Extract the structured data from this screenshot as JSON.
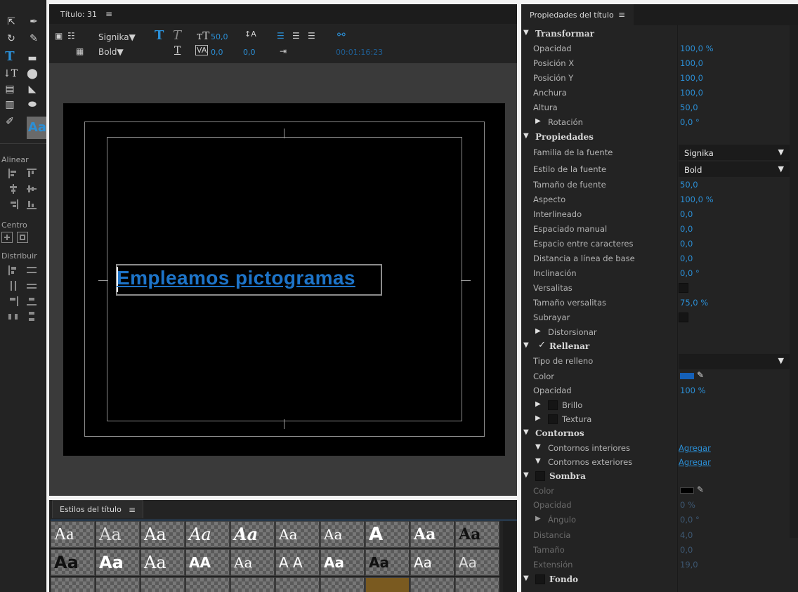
{
  "tools": {
    "labels": {
      "align": "Alinear",
      "center": "Centro",
      "distribute": "Distribuir"
    },
    "icons": [
      "selection-arrow-icon",
      "pen-icon",
      "rotate-icon",
      "add-anchor-icon",
      "type-tool-icon",
      "rectangle-icon",
      "vertical-type-icon",
      "ellipse-icon",
      "area-type-icon",
      "wedge-icon",
      "vertical-area-type-icon",
      "circle-icon",
      "path-type-icon",
      "style-swatch-icon"
    ]
  },
  "editor": {
    "tab_title": "Título: 31",
    "menu_glyph": "≡",
    "font_family": "Signika",
    "font_style": "Bold",
    "font_size": "50,0",
    "kerning": "0,0",
    "leading": "0,0",
    "timecode": "00:01:16:23",
    "headline_text": "Empleamos pictogramas"
  },
  "styles_panel": {
    "tab_title": "Estilos del título",
    "menu_glyph": "≡",
    "row1": [
      "Aa",
      "Aa",
      "Aa",
      "Aa",
      "Aa",
      "Aa",
      "Aa",
      "A",
      "Aa",
      "Aa"
    ],
    "row2": [
      "Aa",
      "Aa",
      "Aa",
      "AA",
      "Aa",
      "A A",
      "Aa",
      "Aa",
      "Aa",
      "Aa"
    ]
  },
  "properties": {
    "tab_title": "Propiedades del título",
    "menu_glyph": "≡",
    "transform_header": "Transformar",
    "rows_transform": [
      {
        "label": "Opacidad",
        "value": "100,0 %"
      },
      {
        "label": "Posición X",
        "value": "100,0"
      },
      {
        "label": "Posición Y",
        "value": "100,0"
      },
      {
        "label": "Anchura",
        "value": "100,0"
      },
      {
        "label": "Altura",
        "value": "50,0"
      }
    ],
    "rotation": {
      "label": "Rotación",
      "value": "0,0 °"
    },
    "props_header": "Propiedades",
    "font_family_label": "Familia de la fuente",
    "font_family_value": "Signika",
    "font_style_label": "Estilo de la fuente",
    "font_style_value": "Bold",
    "rows_props": [
      {
        "label": "Tamaño de fuente",
        "value": "50,0"
      },
      {
        "label": "Aspecto",
        "value": "100,0 %"
      },
      {
        "label": "Interlineado",
        "value": "0,0"
      },
      {
        "label": "Espaciado manual",
        "value": "0,0"
      },
      {
        "label": "Espacio entre caracteres",
        "value": "0,0"
      },
      {
        "label": "Distancia a línea de base",
        "value": "0,0"
      },
      {
        "label": "Inclinación",
        "value": "0,0 °"
      }
    ],
    "smallcaps_label": "Versalitas",
    "smallcaps_size": {
      "label": "Tamaño versalitas",
      "value": "75,0 %"
    },
    "underline_label": "Subrayar",
    "distort_label": "Distorsionar",
    "fill_header": "Rellenar",
    "fill_type_label": "Tipo de relleno",
    "fill_color_label": "Color",
    "fill_color": "#1560b8",
    "fill_opacity": {
      "label": "Opacidad",
      "value": "100 %"
    },
    "sheen_label": "Brillo",
    "texture_label": "Textura",
    "strokes_header": "Contornos",
    "inner_strokes_label": "Contornos interiores",
    "outer_strokes_label": "Contornos exteriores",
    "add_label": "Agregar",
    "shadow_header": "Sombra",
    "shadow_color_label": "Color",
    "shadow_color": "#000000",
    "shadow_rows": [
      {
        "label": "Opacidad",
        "value": "0 %"
      },
      {
        "label": "Distancia",
        "value": "4,0"
      },
      {
        "label": "Tamaño",
        "value": "0,0"
      },
      {
        "label": "Extensión",
        "value": "19,0"
      }
    ],
    "shadow_angle": {
      "label": "Ángulo",
      "value": "0,0 °"
    },
    "background_header": "Fondo"
  }
}
